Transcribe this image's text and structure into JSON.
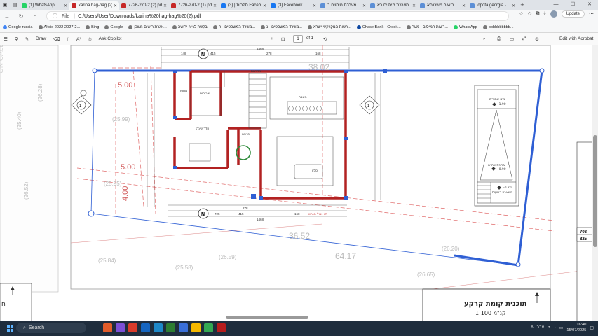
{
  "browser": {
    "tabs": [
      {
        "label": "(1) WhatsApp",
        "color": "#25d366",
        "active": false
      },
      {
        "label": "karina hag-hag (2).pdf",
        "color": "#c62828",
        "active": true
      },
      {
        "label": "7726-270-2 (2).pdf",
        "color": "#c62828",
        "active": false
      },
      {
        "label": "7726-270-2 (1).pdf",
        "color": "#c62828",
        "active": false
      },
      {
        "label": "ספרות | (3) Facebook",
        "color": "#1877f2",
        "active": false
      },
      {
        "label": "(3) Facebook",
        "color": "#1877f2",
        "active": false
      },
      {
        "label": "מערכת מיסוים ב...",
        "color": "#5c8fd6",
        "active": false
      },
      {
        "label": "מערכת מיסוים בא...",
        "color": "#5c8fd6",
        "active": false
      },
      {
        "label": "רישום משכנתא...",
        "color": "#5c8fd6",
        "active": false
      },
      {
        "label": "lopota georgia - ...",
        "color": "#5c8fd6",
        "active": false
      }
    ],
    "address": {
      "file_label": "File",
      "url": "C:/Users/User/Downloads/karina%20hag-hag%20(2).pdf"
    },
    "update_label": "Update",
    "bookmarks": [
      {
        "label": "Google russia",
        "color": "#4285f4"
      },
      {
        "label": "Alfcio 2022-2027-2...",
        "color": "#777"
      },
      {
        "label": "Bing",
        "color": "#777"
      },
      {
        "label": "Google",
        "color": "#777"
      },
      {
        "label": "אגרת רישום משכן...",
        "color": "#777"
      },
      {
        "label": "בקשה לגיור ירושה",
        "color": "#777"
      },
      {
        "label": "משרד המשפטים - ה...",
        "color": "#777"
      },
      {
        "label": "משרד המשפטים - נ...",
        "color": "#777"
      },
      {
        "label": "רשות המקרקעי ישרא...",
        "color": "#777"
      },
      {
        "label": "Chase Bank - Credit...",
        "color": "#0d47a1"
      },
      {
        "label": "רשות המיסים - מער...",
        "color": "#777"
      },
      {
        "label": "WhatsApp",
        "color": "#25d366"
      },
      {
        "label": "bbbbbbbbbb...",
        "color": "#777"
      }
    ]
  },
  "pdf_toolbar": {
    "draw_label": "Draw",
    "ask_label": "Ask Copilot",
    "page_current": "1",
    "page_of": "of 1",
    "edit_label": "Edit with Acrobat",
    "zoom_minus": "−",
    "zoom_plus": "+"
  },
  "drawing": {
    "dim_top_overall": "1468",
    "dim_bottom_overall": "1468",
    "dim_segments": [
      "148",
      "415",
      "278",
      "168"
    ],
    "dim_segments_b": [
      "278",
      "725",
      "415",
      "168"
    ],
    "north_label": "N",
    "section_label": "1",
    "setback_left": "5.00",
    "setback_mid": "5.00",
    "setback_lower": "4.00",
    "elev_top": "38.02",
    "elev_right": "36.52",
    "elev_r2": "64.17",
    "ground_levels": [
      "(25.99)",
      "(25.95)",
      "(25.58)",
      "(25.84)",
      "(26.20)",
      "(26.59)",
      "(26.65)",
      "(26.52)",
      "(25.40)",
      "(26.28)"
    ],
    "rooms": {
      "bedroom": "חדר שינה",
      "living": "סלון",
      "kitchen": "מטבח",
      "stairs": "מדרגות",
      "entry": "כניסה",
      "storage": "מחסן",
      "service": "שירותים"
    },
    "legend_title": "מים שחורים",
    "legend_elev_a": "-1.90",
    "legend_elev_b": "-0.90",
    "legend_elev_c": "-0.20",
    "legend_pit": "בריכת שחייה",
    "legend_sub": "משאבה רביעית",
    "title_block_line1": "תוכנית קומת קרקע",
    "title_block_line2": "קנ\"מ 1:100",
    "scale_right_a": "703",
    "scale_right_b": "825",
    "road_label": "קו גבול מגרש",
    "left_letters": "ח"
  },
  "taskbar": {
    "search_placeholder": "Search",
    "time": "16:40",
    "date": "15/07/2025",
    "lang": "עבר"
  }
}
